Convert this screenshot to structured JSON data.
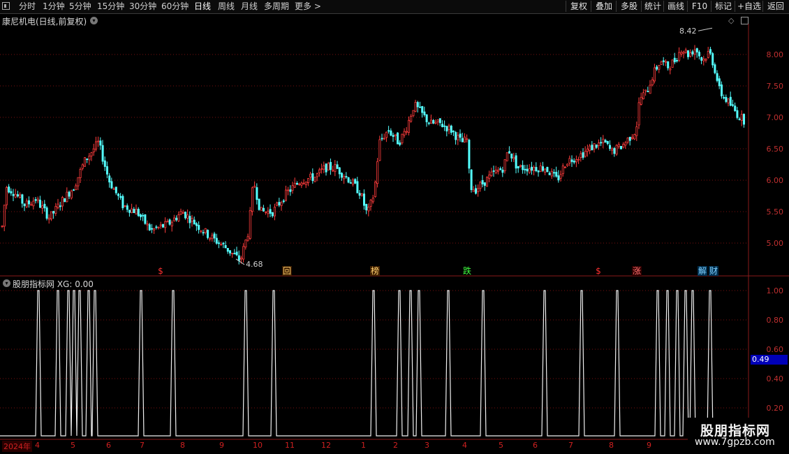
{
  "toolbar": {
    "left_items": [
      "分时",
      "1分钟",
      "5分钟",
      "15分钟",
      "30分钟",
      "60分钟",
      "日线",
      "周线",
      "月线",
      "多周期",
      "更多 >"
    ],
    "active": "日线",
    "right_items": [
      "复权",
      "叠加",
      "多股",
      "统计",
      "画线",
      "F10",
      "标记",
      "+自选",
      "返回"
    ]
  },
  "main_chart": {
    "title": "康尼机电(日线,前复权)",
    "y_ticks": [
      "8.00",
      "7.50",
      "7.00",
      "6.50",
      "6.00",
      "5.50",
      "5.00"
    ],
    "high_label": "8.42",
    "low_label": "4.68"
  },
  "signals": [
    {
      "text": "$",
      "color": "#ff3030"
    },
    {
      "text": "回",
      "color": "#ffd070",
      "bg": "#402000"
    },
    {
      "text": "榜",
      "color": "#ffd070",
      "bg": "#402000"
    },
    {
      "text": "跌",
      "color": "#40ff40"
    },
    {
      "text": "$",
      "color": "#ff3030"
    },
    {
      "text": "涨",
      "color": "#ff7070",
      "bg": "#300000"
    },
    {
      "text": "解",
      "color": "#80d0ff",
      "bg": "#003050"
    },
    {
      "text": "财",
      "color": "#80d0ff",
      "bg": "#003050"
    }
  ],
  "indicator": {
    "title": "股朋指标网  XG: 0.00",
    "y_ticks": [
      "1.00",
      "0.80",
      "0.60",
      "0.40",
      "0.20"
    ],
    "cursor_value": "0.49"
  },
  "date_axis": {
    "labels": [
      "2024年",
      "4",
      "5",
      "6",
      "7",
      "8",
      "9",
      "10",
      "11",
      "12",
      "1",
      "2",
      "3",
      "4",
      "5",
      "6",
      "7",
      "8",
      "9"
    ]
  },
  "watermark": {
    "title": "股朋指标网",
    "url": "www.7gpzb.com"
  },
  "colors": {
    "up": "#ff3c3c",
    "down": "#54ffff",
    "grid": "#7a1010",
    "axis": "#c03030"
  }
}
